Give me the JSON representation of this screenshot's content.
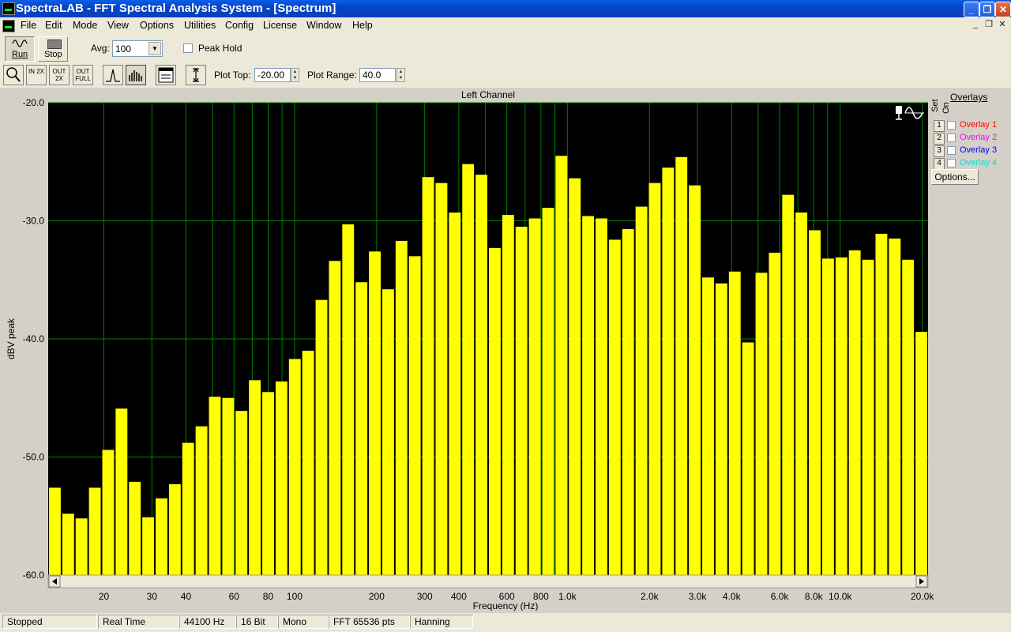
{
  "window": {
    "title": "SpectraLAB - FFT Spectral Analysis System - [Spectrum]"
  },
  "menu": [
    "File",
    "Edit",
    "Mode",
    "View",
    "Options",
    "Utilities",
    "Config",
    "License",
    "Window",
    "Help"
  ],
  "toolbar": {
    "run_label": "Run",
    "stop_label": "Stop",
    "avg_label": "Avg:",
    "avg_value": "100",
    "peak_hold_label": "Peak Hold",
    "zoom_in_label": "IN 2X",
    "zoom_out_label": "OUT 2X",
    "zoom_full_label": "OUT FULL",
    "plot_top_label": "Plot Top:",
    "plot_top_value": "-20.00",
    "plot_range_label": "Plot Range:",
    "plot_range_value": "40.0"
  },
  "overlays": {
    "title": "Overlays",
    "set_label": "Set",
    "on_label": "On",
    "items": [
      {
        "num": "1",
        "label": "Overlay 1",
        "color": "#ff0000"
      },
      {
        "num": "2",
        "label": "Overlay 2",
        "color": "#ff00ff"
      },
      {
        "num": "3",
        "label": "Overlay 3",
        "color": "#0000ff"
      },
      {
        "num": "4",
        "label": "Overlay 4",
        "color": "#00e0e0"
      }
    ],
    "options_label": "Options..."
  },
  "status": [
    "Stopped",
    "Real Time",
    "44100 Hz",
    "16 Bit",
    "Mono",
    "FFT 65536 pts",
    "Hanning"
  ],
  "chart_data": {
    "type": "bar",
    "title": "Left Channel",
    "xlabel": "Frequency (Hz)",
    "ylabel": "dBV peak",
    "x_scale": "log",
    "xlim": [
      12.5,
      21000
    ],
    "ylim": [
      -60,
      -20
    ],
    "grid": true,
    "background": "#000000",
    "bar_color": "#ffff00",
    "grid_color": "#008000",
    "ytick_labels": [
      "-20.0",
      "-30.0",
      "-40.0",
      "-50.0",
      "-60.0"
    ],
    "ytick_values": [
      -20,
      -30,
      -40,
      -50,
      -60
    ],
    "xtick_labels": [
      "20",
      "30",
      "40",
      "60",
      "80",
      "100",
      "200",
      "300",
      "400",
      "600",
      "800",
      "1.0k",
      "2.0k",
      "3.0k",
      "4.0k",
      "6.0k",
      "8.0k",
      "10.0k",
      "20.0k"
    ],
    "xtick_values": [
      20,
      30,
      40,
      60,
      80,
      100,
      200,
      300,
      400,
      600,
      800,
      1000,
      2000,
      3000,
      4000,
      6000,
      8000,
      10000,
      20000
    ],
    "grid_freqs": [
      20,
      30,
      40,
      50,
      60,
      70,
      80,
      90,
      100,
      200,
      300,
      400,
      500,
      600,
      700,
      800,
      900,
      1000,
      2000,
      3000,
      4000,
      5000,
      6000,
      7000,
      8000,
      9000,
      10000,
      20000
    ],
    "values": [
      -52.6,
      -54.8,
      -55.2,
      -52.6,
      -49.4,
      -45.9,
      -52.1,
      -55.1,
      -53.5,
      -52.3,
      -48.8,
      -47.4,
      -44.9,
      -45.0,
      -46.1,
      -43.5,
      -44.5,
      -43.6,
      -41.7,
      -41.0,
      -36.7,
      -33.4,
      -30.3,
      -35.2,
      -32.6,
      -35.8,
      -31.7,
      -33.0,
      -26.3,
      -26.8,
      -29.3,
      -25.2,
      -26.1,
      -32.3,
      -29.5,
      -30.5,
      -29.8,
      -28.9,
      -24.5,
      -26.4,
      -29.6,
      -29.8,
      -31.6,
      -30.7,
      -28.8,
      -26.8,
      -25.5,
      -24.6,
      -27.0,
      -34.8,
      -35.3,
      -34.3,
      -40.3,
      -34.4,
      -32.7,
      -27.8,
      -29.3,
      -30.8,
      -33.2,
      -33.1,
      -32.5,
      -33.3,
      -31.1,
      -31.5,
      -33.3,
      -39.4
    ]
  }
}
